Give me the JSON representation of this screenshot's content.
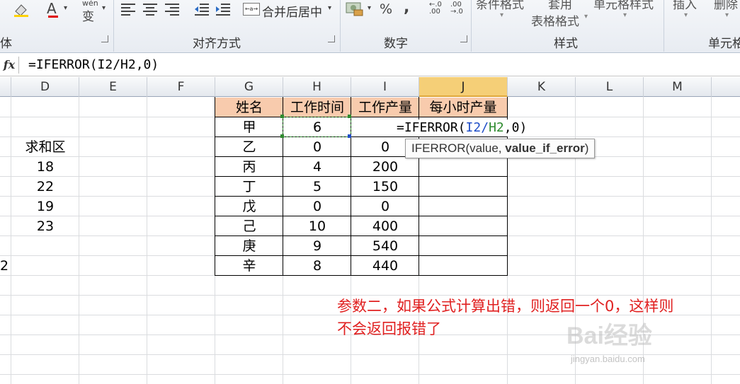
{
  "ribbon": {
    "font_color_glyph": "A",
    "wen_glyph": "wén",
    "wen_char": "变",
    "merge_center_label": "合并后居中",
    "percent_label": "%",
    "comma_label": ",",
    "cond_format_label": "条件格式",
    "apply_label": "套用",
    "table_format_label": "表格格式",
    "cell_style_label": "单元格样式",
    "insert_label": "插入",
    "delete_label": "删除",
    "group_font_partial": "体",
    "group_alignment": "对齐方式",
    "group_number": "数字",
    "group_styles": "样式",
    "group_cells_partial": "单元格"
  },
  "formula_bar": {
    "fx_label": "fx",
    "formula": "=IFERROR(I2/H2,0)"
  },
  "columns": [
    "D",
    "E",
    "F",
    "G",
    "H",
    "I",
    "J",
    "K",
    "L",
    "M"
  ],
  "sheet": {
    "sum_area_label": "求和区",
    "sum_values": [
      "18",
      "22",
      "19",
      "23"
    ],
    "partial_row_value": "2",
    "table_headers": [
      "姓名",
      "工作时间",
      "工作产量",
      "每小时产量"
    ],
    "rows": [
      {
        "name": "甲",
        "hours": "6",
        "output": ""
      },
      {
        "name": "乙",
        "hours": "0",
        "output": "0"
      },
      {
        "name": "丙",
        "hours": "4",
        "output": "200"
      },
      {
        "name": "丁",
        "hours": "5",
        "output": "150"
      },
      {
        "name": "戊",
        "hours": "0",
        "output": "0"
      },
      {
        "name": "己",
        "hours": "10",
        "output": "400"
      },
      {
        "name": "庚",
        "hours": "9",
        "output": "540"
      },
      {
        "name": "辛",
        "hours": "8",
        "output": "440"
      }
    ],
    "edit_formula": {
      "prefix": "=IFERROR(",
      "ref1": "I2",
      "slash": "/",
      "ref2": "H2",
      "suffix": ",0)"
    },
    "tooltip": {
      "func": "IFERROR(value, ",
      "bold_arg": "value_if_error",
      "close": ")"
    }
  },
  "annotation": {
    "line1": "参数二，如果公式计算出错，则返回一个0，这样则",
    "line2": "不会返回报错了"
  },
  "watermark": {
    "brand": "Bai经验",
    "url": "jingyan.baidu.com"
  },
  "colors": {
    "header_fill": "#f8cbad",
    "active_column": "#f5cf77",
    "note_red": "#e02020",
    "ref_blue": "#1f4ec8",
    "ref_green": "#2e8b2e"
  }
}
